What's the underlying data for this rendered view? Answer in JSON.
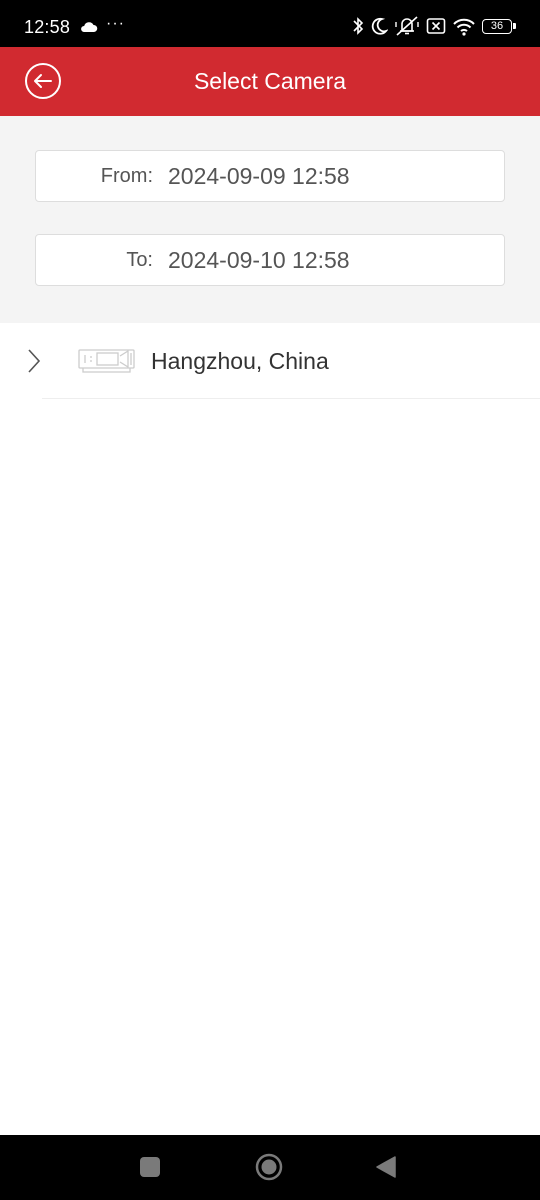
{
  "status_bar": {
    "time": "12:58",
    "dots": "···",
    "battery": "36",
    "icons": [
      "cloud-icon",
      "bluetooth-icon",
      "moon-icon",
      "vibrate-off-icon",
      "sim-off-icon",
      "wifi-icon",
      "battery-icon"
    ]
  },
  "header": {
    "title": "Select Camera",
    "back_icon": "back-arrow-circle-icon",
    "color": "#d12a30"
  },
  "time_range": {
    "from_label": "From:",
    "from_value": "2024-09-09 12:58",
    "to_label": "To:",
    "to_value": "2024-09-10 12:58"
  },
  "camera_list": {
    "items": [
      {
        "name": "Hangzhou, China",
        "icons": [
          "chevron-right-icon",
          "video-device-icon"
        ]
      }
    ]
  },
  "nav_bar": {
    "buttons": [
      "recents-square-icon",
      "home-circle-icon",
      "back-triangle-icon"
    ]
  }
}
